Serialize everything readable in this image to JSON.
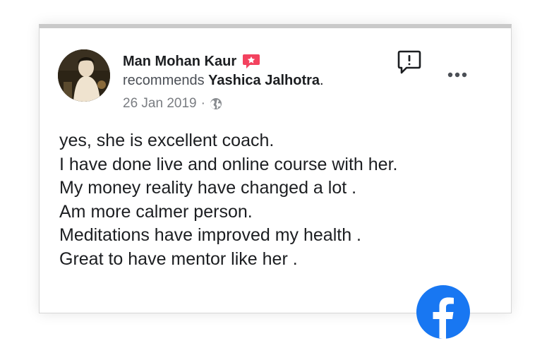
{
  "post": {
    "author": "Man Mohan Kaur",
    "recommend_verb": "recommends",
    "recommended_name": "Yashica Jalhotra",
    "recommended_suffix": ".",
    "date": "26 Jan 2019",
    "separator": "·",
    "privacy_icon": "globe-icon",
    "badge_icon": "recommendation-badge-icon",
    "badge_color": "#f3425f",
    "report_icon": "report-flag-icon",
    "more_icon": "more-options-icon",
    "body_lines": [
      "yes, she is excellent coach.",
      "I have done live and online course with her.",
      "My money reality have changed a lot .",
      "Am more calmer person.",
      "Meditations have improved my health .",
      "Great to have mentor like her ."
    ]
  },
  "brand": {
    "logo_icon": "facebook-logo-icon",
    "color": "#1877f2"
  }
}
